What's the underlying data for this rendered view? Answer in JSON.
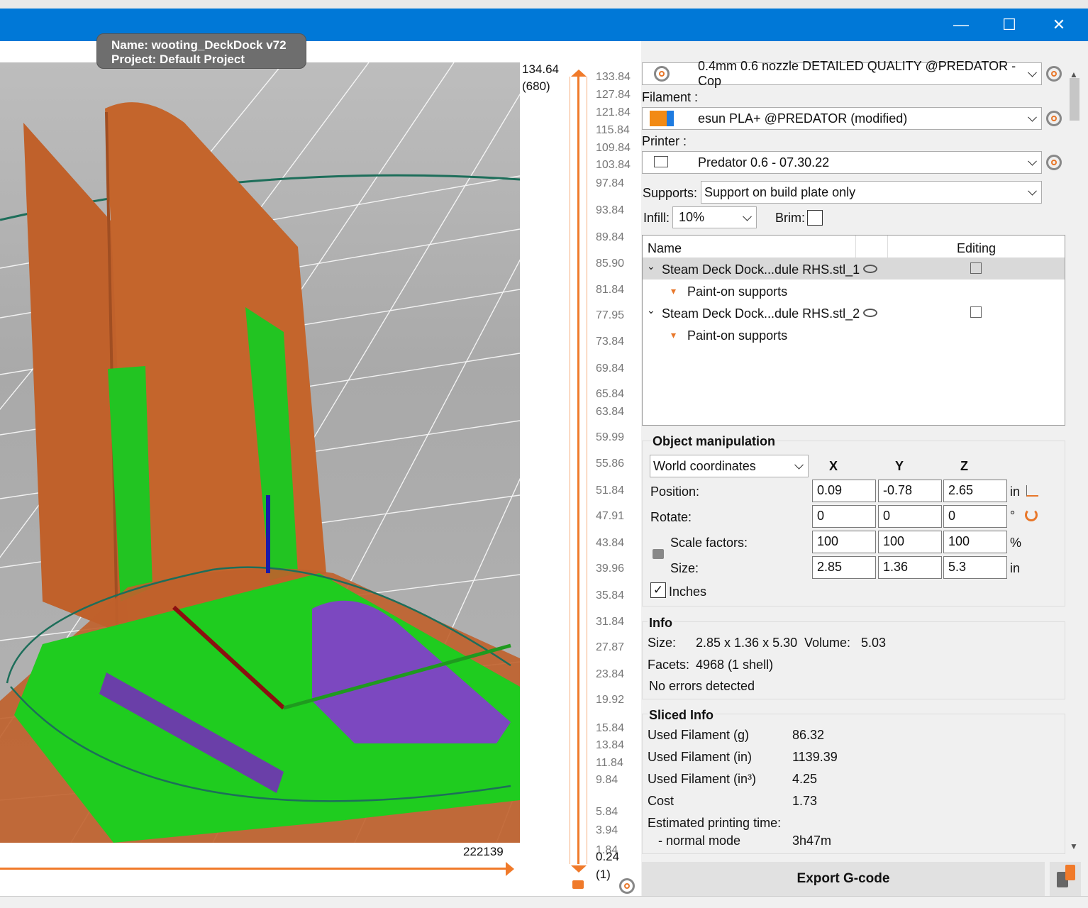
{
  "window": {
    "tooltip_line1": "Name: wooting_DeckDock v72",
    "tooltip_line2": "Project: Default Project",
    "controls": [
      "—",
      "☐",
      "✕"
    ]
  },
  "slider": {
    "top_value": "134.64",
    "top_layer": "(680)",
    "bottom_value": "0.24",
    "bottom_layer": "(1)",
    "ticks": [
      "133.84",
      "127.84",
      "121.84",
      "115.84",
      "109.84",
      "103.84",
      "97.84",
      "93.84",
      "89.84",
      "85.90",
      "81.84",
      "77.95",
      "73.84",
      "69.84",
      "65.84",
      "63.84",
      "59.99",
      "55.86",
      "51.84",
      "47.91",
      "43.84",
      "39.96",
      "35.84",
      "31.84",
      "27.87",
      "23.84",
      "19.92",
      "15.84",
      "13.84",
      "11.84",
      "9.84",
      "5.84",
      "3.94",
      "1.84"
    ],
    "horizontal_value": "222139"
  },
  "settings": {
    "print_profile": "0.4mm 0.6 nozzle DETAILED QUALITY @PREDATOR - Cop",
    "filament_label": "Filament :",
    "filament": "esun PLA+ @PREDATOR (modified)",
    "printer_label": "Printer :",
    "printer": "Predator 0.6 - 07.30.22",
    "supports_label": "Supports:",
    "supports": "Support on build plate only",
    "infill_label": "Infill:",
    "infill": "10%",
    "brim_label": "Brim:"
  },
  "object_list": {
    "col_name": "Name",
    "col_editing": "Editing",
    "items": [
      {
        "name": "Steam Deck Dock...dule RHS.stl_1",
        "child": "Paint-on supports"
      },
      {
        "name": "Steam Deck Dock...dule RHS.stl_2",
        "child": "Paint-on supports"
      }
    ]
  },
  "manipulation": {
    "title": "Object manipulation",
    "coord_mode": "World coordinates",
    "axes": [
      "X",
      "Y",
      "Z"
    ],
    "position_label": "Position:",
    "position": [
      "0.09",
      "-0.78",
      "2.65"
    ],
    "position_unit": "in",
    "rotate_label": "Rotate:",
    "rotate": [
      "0",
      "0",
      "0"
    ],
    "rotate_unit": "°",
    "scale_label": "Scale factors:",
    "scale": [
      "100",
      "100",
      "100"
    ],
    "scale_unit": "%",
    "size_label": "Size:",
    "size": [
      "2.85",
      "1.36",
      "5.3"
    ],
    "size_unit": "in",
    "inches_label": "Inches"
  },
  "info": {
    "title": "Info",
    "size_label": "Size:",
    "size_value": "2.85 x 1.36 x 5.30",
    "volume_label": "Volume:",
    "volume_value": "5.03",
    "facets_label": "Facets:",
    "facets_value": "4968 (1 shell)",
    "errors": "No errors detected"
  },
  "sliced": {
    "title": "Sliced Info",
    "rows": [
      {
        "label": "Used Filament (g)",
        "value": "86.32"
      },
      {
        "label": "Used Filament (in)",
        "value": "1139.39"
      },
      {
        "label": "Used Filament (in³)",
        "value": "4.25"
      },
      {
        "label": "Cost",
        "value": "1.73"
      }
    ],
    "time_label": "Estimated printing time:",
    "mode_label": "- normal mode",
    "mode_value": "3h47m"
  },
  "export_label": "Export G-code",
  "colors": {
    "accent": "#0078d7",
    "slider": "#f07a2a",
    "model": "#c0612b",
    "support": "#22c422"
  }
}
